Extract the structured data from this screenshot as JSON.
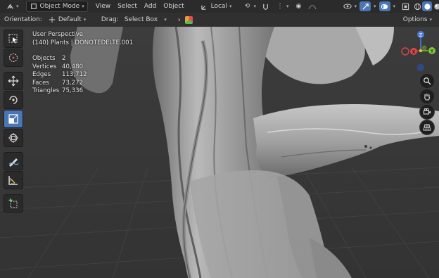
{
  "header": {
    "mode": "Object Mode",
    "menus": [
      "View",
      "Select",
      "Add",
      "Object"
    ],
    "transform_orientation": "Local",
    "colors": {
      "bar": "#2b2b2b",
      "active": "#4a76b6"
    }
  },
  "subheader": {
    "orientation_label": "Orientation:",
    "orientation_value": "Default",
    "drag_label": "Drag:",
    "drag_value": "Select Box",
    "options_label": "Options"
  },
  "toolbar": {
    "tools": [
      {
        "icon": "select-box-icon",
        "active": false
      },
      {
        "icon": "cursor-icon",
        "active": false
      },
      {
        "icon": "move-icon",
        "active": false
      },
      {
        "icon": "rotate-icon",
        "active": false
      },
      {
        "icon": "scale-icon",
        "active": true
      },
      {
        "icon": "transform-icon",
        "active": false
      },
      {
        "icon": "annotate-icon",
        "active": false
      },
      {
        "icon": "measure-icon",
        "active": false
      },
      {
        "icon": "add-cube-icon",
        "active": false
      }
    ]
  },
  "viewport": {
    "perspective": "User Perspective",
    "collection": "(140) Plants | DONOTEDELTE.001",
    "stats": [
      {
        "label": "Objects",
        "value": "2"
      },
      {
        "label": "Vertices",
        "value": "40,480"
      },
      {
        "label": "Edges",
        "value": "113,712"
      },
      {
        "label": "Faces",
        "value": "73,272"
      },
      {
        "label": "Triangles",
        "value": "75,336"
      }
    ]
  },
  "gizmo": {
    "x": "X",
    "y": "Y",
    "z": "Z"
  }
}
